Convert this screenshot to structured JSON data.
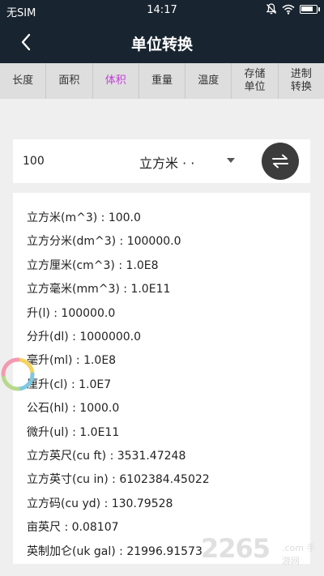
{
  "status_bar": {
    "carrier": "无SIM",
    "time": "14:17",
    "battery_level": 0.85
  },
  "app_bar": {
    "title": "单位转换",
    "back_icon": "chevron-left-icon"
  },
  "tabs": [
    {
      "label": "长度",
      "active": false
    },
    {
      "label": "面积",
      "active": false
    },
    {
      "label": "体积",
      "active": true
    },
    {
      "label": "重量",
      "active": false
    },
    {
      "label": "温度",
      "active": false
    },
    {
      "label": "存储\n单位",
      "active": false
    },
    {
      "label": "进制\n转换",
      "active": false
    }
  ],
  "converter": {
    "input_value": "100",
    "unit": "立方米 · ·",
    "swap_icon": "swap-arrows-icon"
  },
  "results": [
    "立方米(m^3) : 100.0",
    "立方分米(dm^3) : 100000.0",
    "立方厘米(cm^3) : 1.0E8",
    "立方毫米(mm^3) : 1.0E11",
    "升(l) : 100000.0",
    "分升(dl) : 1000000.0",
    "毫升(ml) : 1.0E8",
    "厘升(cl) : 1.0E7",
    "公石(hl) : 1000.0",
    "微升(ul) : 1.0E11",
    "立方英尺(cu ft) : 3531.47248",
    "立方英寸(cu in) : 6102384.45022",
    "立方码(cu yd) : 130.79528",
    "亩英尺 : 0.08107",
    "英制加仑(uk gal) : 21996.91573"
  ],
  "watermark": {
    "number": "2265",
    "text": ".com 手游网"
  },
  "colors": {
    "header_bg": "#18242f",
    "active_tab": "#c23bd8",
    "swap_button": "#3c3c3c"
  }
}
